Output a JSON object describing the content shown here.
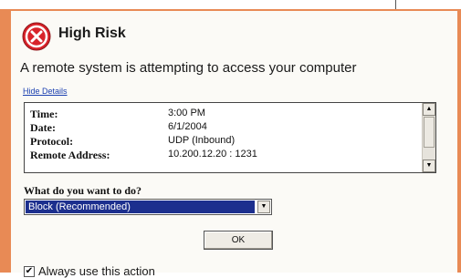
{
  "dialog": {
    "title": "High Risk",
    "severity_icon": "high-risk-icon",
    "message": "A remote system is attempting to access your computer",
    "hide_details_label": "Hide Details"
  },
  "details": {
    "rows": [
      {
        "key": "Time:",
        "value": "3:00 PM"
      },
      {
        "key": "Date:",
        "value": "6/1/2004"
      },
      {
        "key": "Protocol:",
        "value": "UDP (Inbound)"
      },
      {
        "key": "Remote Address:",
        "value": "10.200.12.20 : 1231"
      }
    ]
  },
  "action": {
    "question": "What do you want to do?",
    "selected": "Block (Recommended)"
  },
  "ok_button": {
    "label": "OK"
  },
  "always": {
    "label": "Always use this action",
    "checked": true
  },
  "colors": {
    "frame": "#e88a55",
    "selection": "#1c2f8e",
    "icon": "#d8232a"
  }
}
